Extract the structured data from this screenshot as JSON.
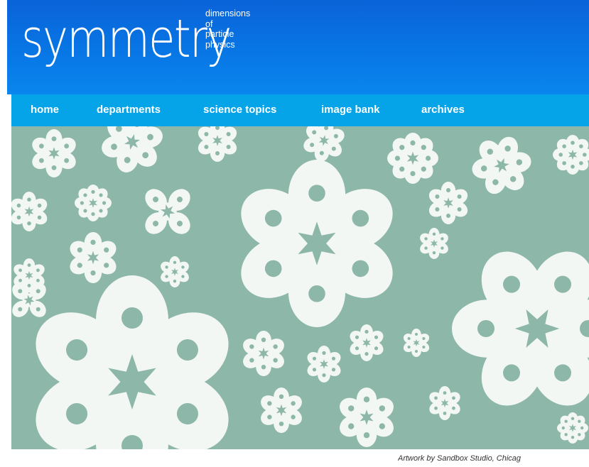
{
  "site": {
    "logo_text": "symmetry",
    "tagline": [
      "dimensions",
      "of",
      "particle",
      "physics"
    ]
  },
  "nav": {
    "items": [
      {
        "label": "home"
      },
      {
        "label": "departments"
      },
      {
        "label": "science topics"
      },
      {
        "label": "image bank"
      },
      {
        "label": "archives"
      }
    ]
  },
  "hero": {
    "caption": "Artwork by Sandbox Studio, Chicag"
  },
  "colors": {
    "header_blue": "#0878e6",
    "nav_blue": "#05a4e8",
    "hero_background": "#8db7a9",
    "paper_white": "#f2f7f3"
  }
}
